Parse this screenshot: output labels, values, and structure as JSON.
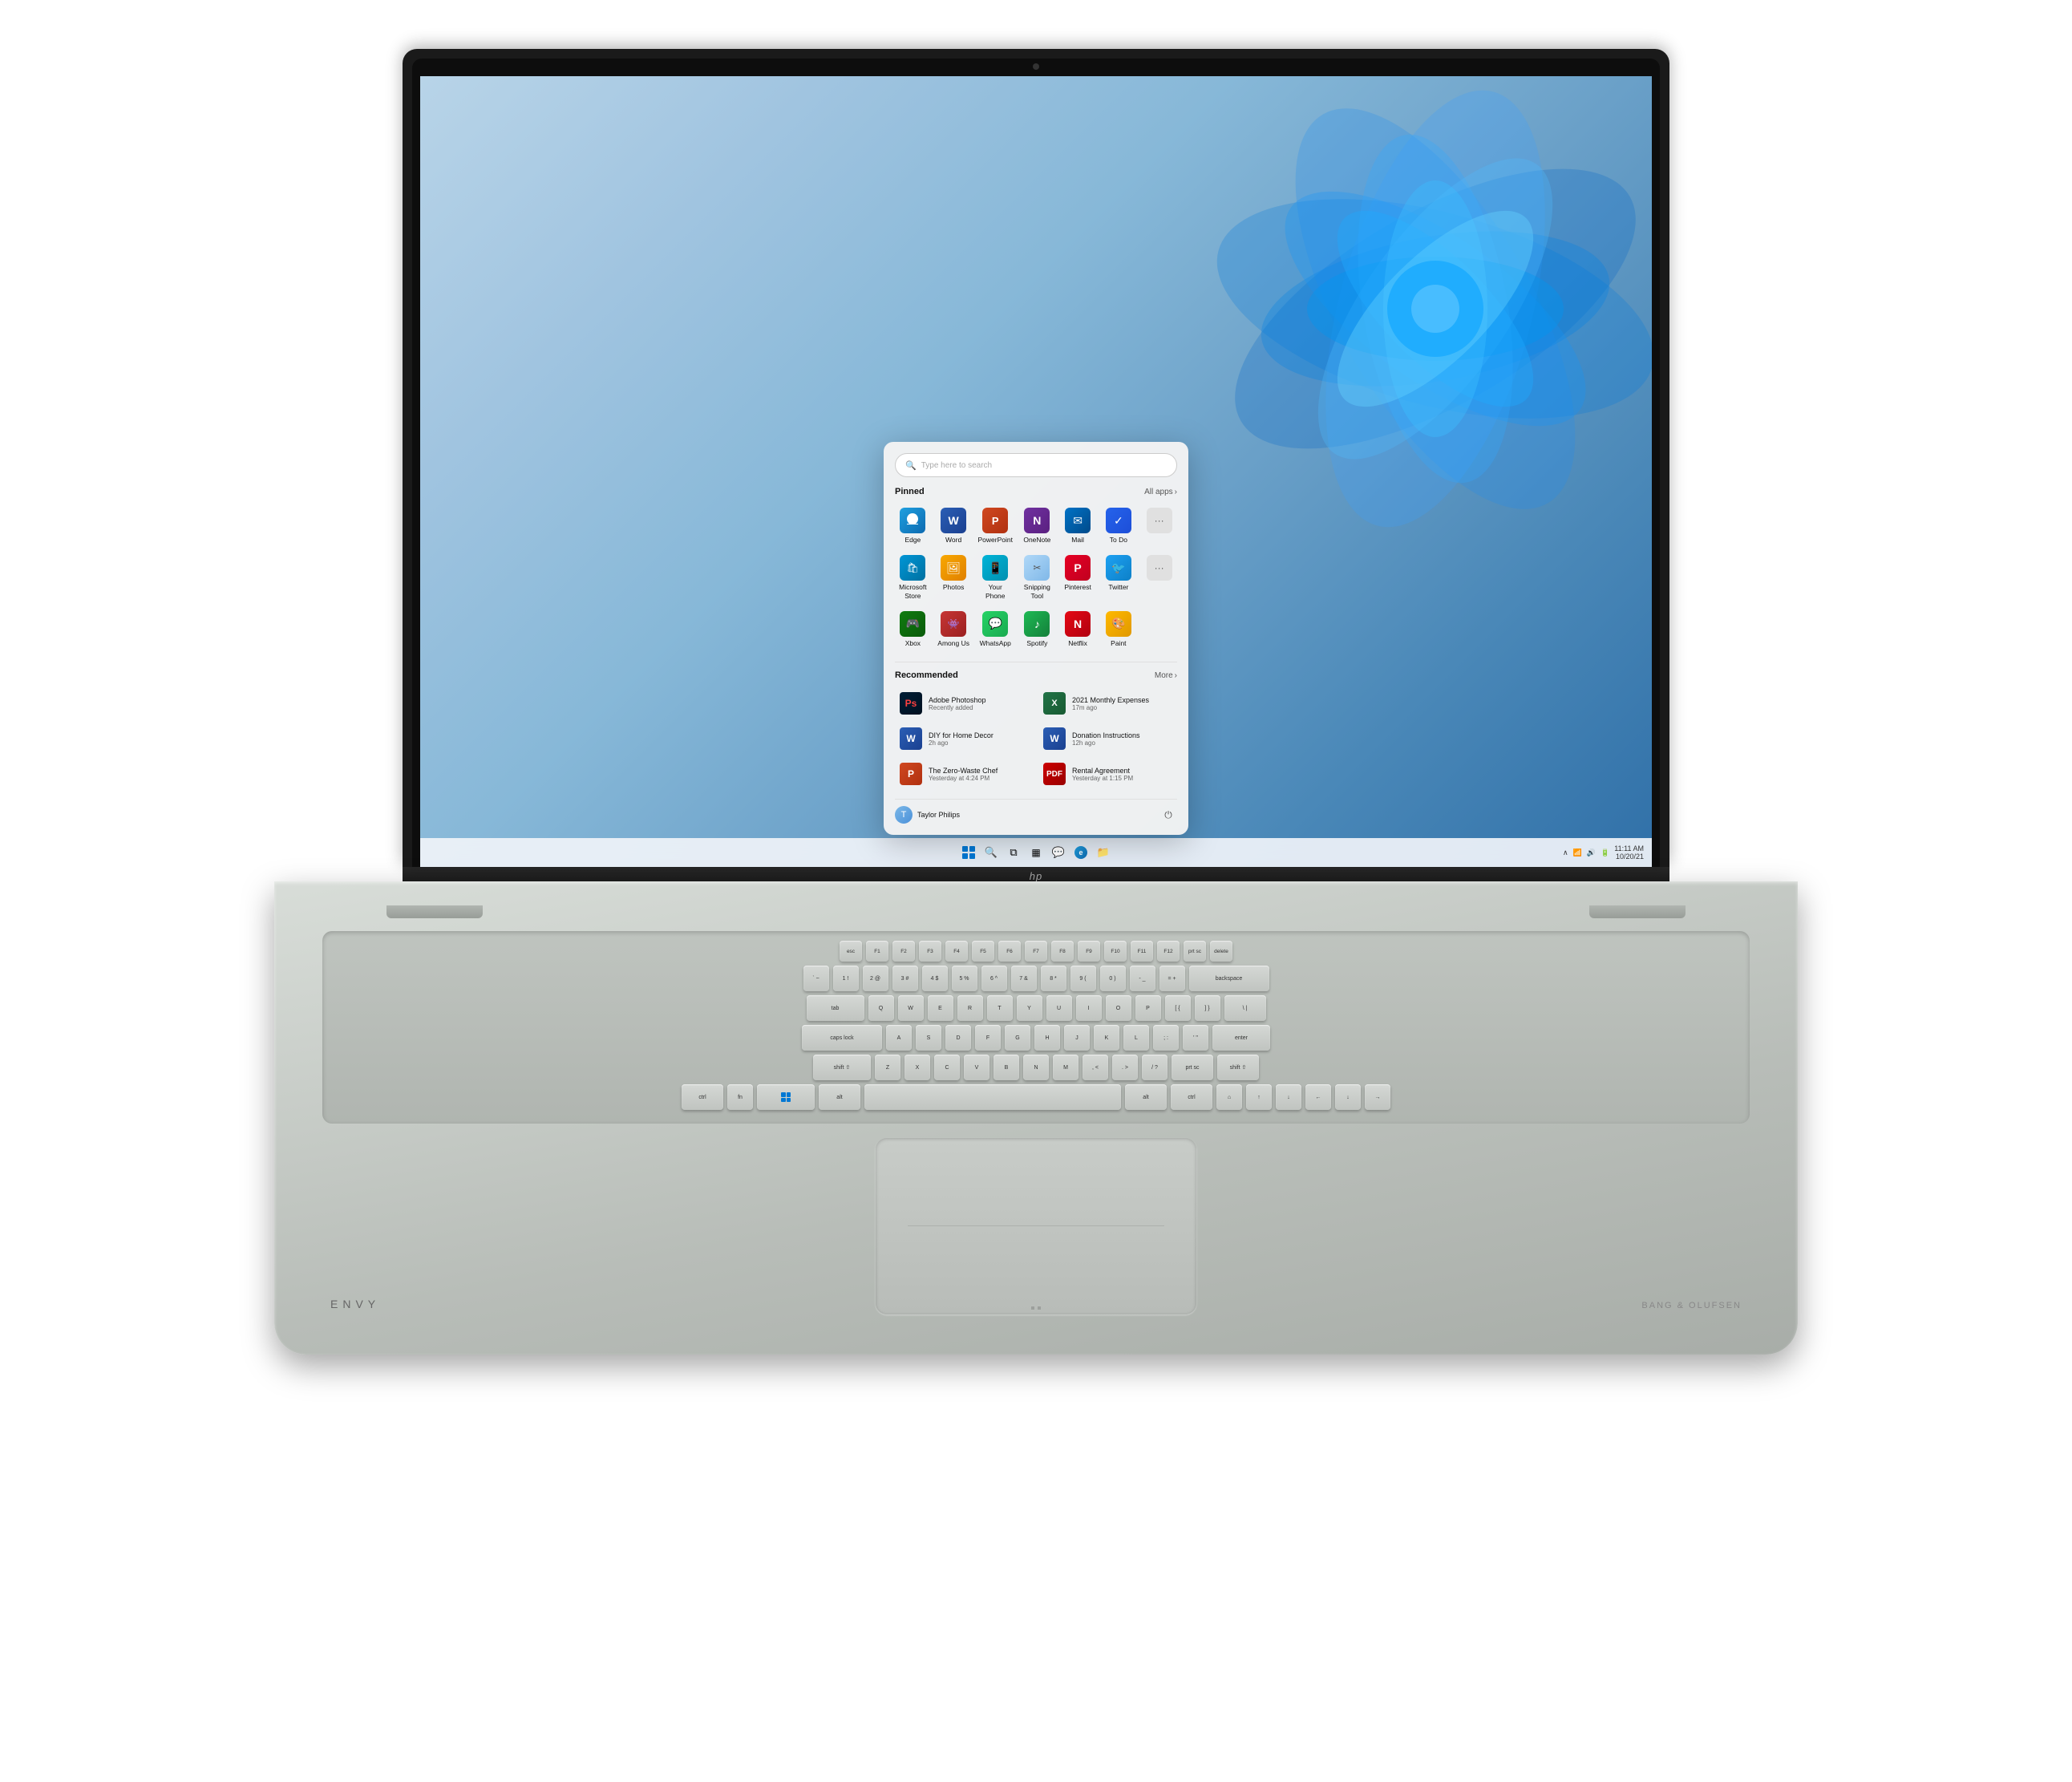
{
  "laptop": {
    "brand": "ENVY",
    "brand_audio": "BANG & OLUFSEN",
    "hp_logo": "hp"
  },
  "screen": {
    "wallpaper_desc": "Windows 11 bloom wallpaper"
  },
  "taskbar": {
    "time": "11:11 AM",
    "date": "10/20/21",
    "icons": [
      "windows",
      "search",
      "task-view",
      "widgets",
      "chat",
      "edge",
      "file-explorer"
    ],
    "system_tray": [
      "chevron-up",
      "network",
      "volume",
      "battery"
    ]
  },
  "start_menu": {
    "search_placeholder": "Type here to search",
    "pinned_section": {
      "title": "Pinned",
      "all_apps_label": "All apps",
      "apps": [
        {
          "name": "Edge",
          "icon": "edge"
        },
        {
          "name": "Word",
          "icon": "word"
        },
        {
          "name": "PowerPoint",
          "icon": "ppt"
        },
        {
          "name": "OneNote",
          "icon": "onenote"
        },
        {
          "name": "Mail",
          "icon": "mail"
        },
        {
          "name": "To Do",
          "icon": "todo"
        },
        {
          "name": "Microsoft Store",
          "icon": "msstore"
        },
        {
          "name": "Photos",
          "icon": "photos"
        },
        {
          "name": "Your Phone",
          "icon": "phone"
        },
        {
          "name": "Snipping Tool",
          "icon": "snipping"
        },
        {
          "name": "Pinterest",
          "icon": "pinterest"
        },
        {
          "name": "Twitter",
          "icon": "twitter"
        },
        {
          "name": "Xbox",
          "icon": "xbox"
        },
        {
          "name": "Among Us",
          "icon": "among"
        },
        {
          "name": "WhatsApp",
          "icon": "whatsapp"
        },
        {
          "name": "Spotify",
          "icon": "spotify"
        },
        {
          "name": "Netflix",
          "icon": "netflix"
        },
        {
          "name": "Paint",
          "icon": "paint"
        }
      ]
    },
    "recommended_section": {
      "title": "Recommended",
      "more_label": "More",
      "items": [
        {
          "name": "Adobe Photoshop",
          "time": "Recently added",
          "icon": "adobe"
        },
        {
          "name": "2021 Monthly Expenses",
          "time": "17m ago",
          "icon": "excel"
        },
        {
          "name": "DIY for Home Decor",
          "time": "2h ago",
          "icon": "word"
        },
        {
          "name": "Donation Instructions",
          "time": "12h ago",
          "icon": "word"
        },
        {
          "name": "The Zero-Waste Chef",
          "time": "Yesterday at 4:24 PM",
          "icon": "ppt"
        },
        {
          "name": "Rental Agreement",
          "time": "Yesterday at 1:15 PM",
          "icon": "pdf"
        }
      ]
    },
    "user": {
      "name": "Taylor Philips",
      "avatar_initial": "T"
    },
    "power_button": "⏻"
  }
}
